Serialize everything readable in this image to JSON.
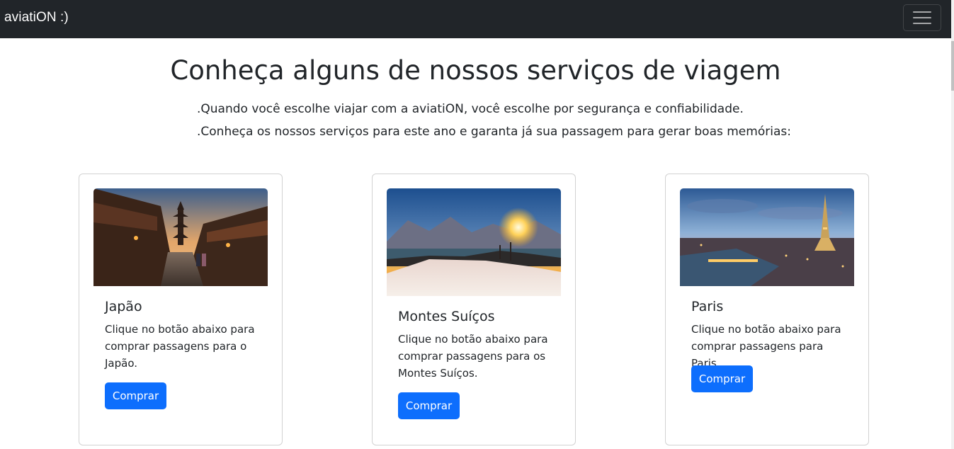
{
  "navbar": {
    "brand": "aviatiON :)",
    "toggler_icon": "hamburger-menu-icon"
  },
  "main": {
    "title": "Conheça alguns de nossos serviços de viagem",
    "lead_1": ".Quando você escolhe viajar com a aviatiON, você escolhe por segurança e confiabilidade.",
    "lead_2": ".Conheça os nossos serviços para este ano e garanta já sua passagem para gerar boas memórias:"
  },
  "cards": [
    {
      "title": "Japão",
      "text": "Clique no botão abaixo para comprar passagens para o Japão.",
      "button": "Comprar",
      "image": "kyoto-street-pagoda-photo"
    },
    {
      "title": "Montes Suíços",
      "text": "Clique no botão abaixo para comprar passagens para os Montes Suíços.",
      "button": "Comprar",
      "image": "swiss-mountains-sunset-photo"
    },
    {
      "title": "Paris",
      "text": "Clique no botão abaixo para comprar passagens para Paris.",
      "button": "Comprar",
      "image": "paris-eiffel-tower-photo"
    }
  ],
  "colors": {
    "navbar_bg": "#212529",
    "button_primary": "#0d6efd"
  }
}
